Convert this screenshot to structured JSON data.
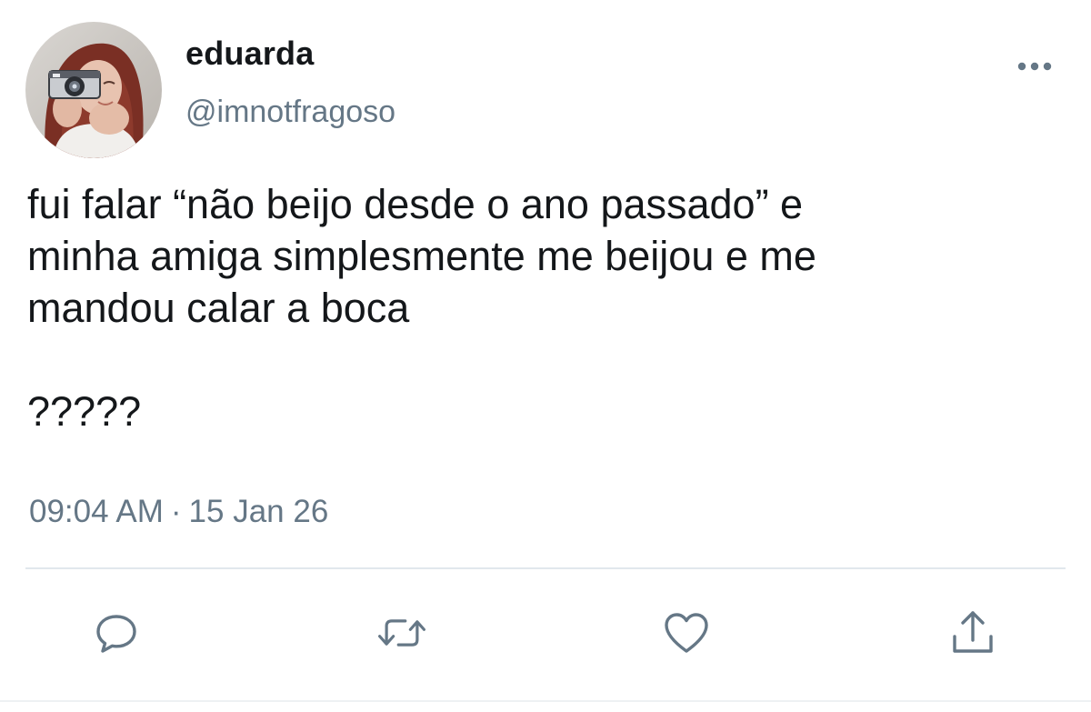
{
  "user": {
    "display_name": "eduarda",
    "handle": "@imnotfragoso"
  },
  "tweet": {
    "text": "fui falar “não beijo desde o ano passado” e\nminha amiga simplesmente me beijou e me\nmandou calar a boca\n\n?????",
    "time": "09:04 AM",
    "separator": "·",
    "date": "15 Jan 26"
  },
  "actions": {
    "reply_icon": "speech-bubble-icon",
    "retweet_icon": "retweet-arrows-icon",
    "like_icon": "heart-icon",
    "share_icon": "upload-arrow-icon",
    "more_icon": "ellipsis-icon"
  },
  "colors": {
    "text": "#14171a",
    "secondary": "#657786",
    "divider": "#e1e8ed"
  }
}
